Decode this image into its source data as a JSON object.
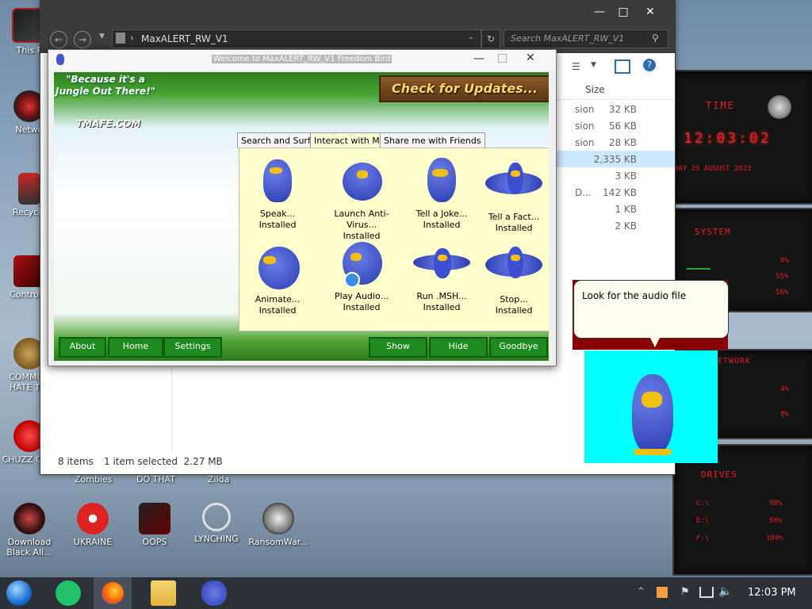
{
  "desktop": {
    "icons": [
      {
        "label": "This P"
      },
      {
        "label": "Netwo"
      },
      {
        "label": "Recycle"
      },
      {
        "label": "Control P"
      },
      {
        "label": "COMMUN HATE THI"
      },
      {
        "label": "CHUZZ CLIM"
      },
      {
        "label": "Download Black Ali..."
      },
      {
        "label": "UKRAINE"
      },
      {
        "label": "OOPS"
      },
      {
        "label": "LYNCHING"
      },
      {
        "label": "RansomWar..."
      }
    ],
    "partial_labels": [
      "Zombies",
      "DO THAT",
      "Zilda"
    ]
  },
  "explorer": {
    "path": "MaxALERT_RW_V1",
    "search_placeholder": "Search MaxALERT_RW_V1",
    "col_size": "Size",
    "rows": [
      {
        "type": "sion",
        "size": "32 KB"
      },
      {
        "type": "sion",
        "size": "56 KB"
      },
      {
        "type": "sion",
        "size": "28 KB"
      },
      {
        "type": "",
        "size": "2,335 KB"
      },
      {
        "type": "",
        "size": "3 KB"
      },
      {
        "type": "D...",
        "size": "142 KB"
      },
      {
        "type": "",
        "size": "1 KB"
      },
      {
        "type": "",
        "size": "2 KB"
      }
    ],
    "status_items": "8 items",
    "status_selected": "1 item selected  2.27 MB",
    "min": "—",
    "max": "□",
    "close": "✕"
  },
  "tmafe": {
    "title": "Welcome to MaxALERT_RW_V1 Freedom Bird",
    "slogan": "\"Because it's a Jungle Out There!\"",
    "logo": "TMAFE.COM",
    "update_banner": "Check for Updates...",
    "tabs": [
      "Search and Surf",
      "Interact with Me",
      "Share me with Friends"
    ],
    "items": [
      {
        "name": "Speak...",
        "status": "Installed"
      },
      {
        "name": "Launch Anti-Virus...",
        "status": "Installed"
      },
      {
        "name": "Tell a Joke...",
        "status": "Installed"
      },
      {
        "name": "Tell a Fact...",
        "status": "Installed"
      },
      {
        "name": "Animate...",
        "status": "Installed"
      },
      {
        "name": "Play Audio...",
        "status": "Installed"
      },
      {
        "name": "Run .MSH...",
        "status": "Installed"
      },
      {
        "name": "Stop...",
        "status": "Installed"
      }
    ],
    "buttons_left": [
      "About",
      "Home",
      "Settings"
    ],
    "buttons_right": [
      "Show",
      "Hide",
      "Goodbye"
    ]
  },
  "balloon": {
    "text": "Look for the audio file"
  },
  "gadgets": {
    "time_label": "TIME",
    "time": "12:03:02",
    "date": "DAY 29 AUGUST 2023",
    "system_label": "SYSTEM",
    "sys_vals": [
      "8%",
      "55%",
      "56%"
    ],
    "network_label": "NETWORK",
    "net_vals": [
      "4%",
      "8%"
    ],
    "drives_label": "DRIVES",
    "drive_vals": [
      "C:\\",
      "E:\\",
      "F:\\"
    ],
    "drive_pcts": [
      "98%",
      "98%",
      "100%"
    ]
  },
  "taskbar": {
    "clock": "12:03 PM"
  }
}
